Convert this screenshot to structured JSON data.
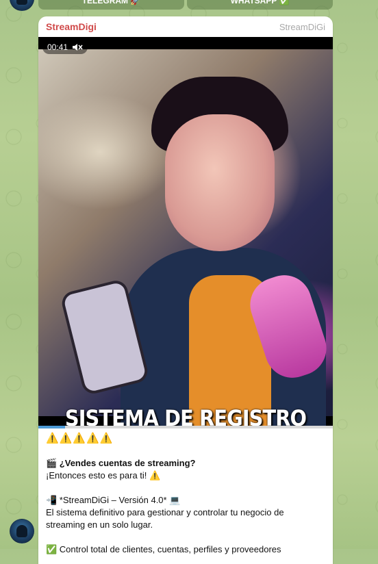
{
  "top_buttons": [
    {
      "label": "TELEGRAM 🚀"
    },
    {
      "label": "WHATSAPP ✅"
    }
  ],
  "message": {
    "sender": "StreamDigi",
    "via": "StreamDiGi",
    "video": {
      "time": "00:41",
      "muted": true,
      "overlay_text": "SISTEMA DE REGISTRO",
      "progress_percent": 9
    },
    "lines": {
      "warnings": "⚠️⚠️⚠️⚠️⚠️",
      "question": "🎬 ¿Vendes cuentas de streaming?",
      "answer": "¡Entonces esto es para ti! ⚠️",
      "version": "📲 *StreamDiGi – Versión 4.0* 💻",
      "desc1": "El sistema definitivo para gestionar y controlar tu negocio de",
      "desc2": "streaming en un solo lugar.",
      "feature1": "✅ Control total de clientes, cuentas, perfiles y proveedores"
    }
  },
  "colors": {
    "sender": "#d04a4a",
    "progress": "#4d9ad6",
    "background": "#a9c58a"
  }
}
